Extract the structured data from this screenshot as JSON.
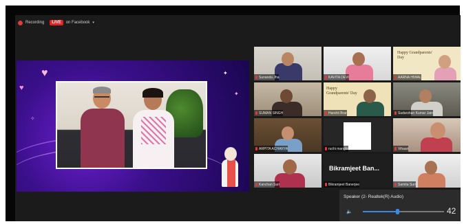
{
  "topbar": {
    "recording_label": "Recording",
    "live_label": "LIVE",
    "facebook_label": "on Facebook",
    "dropdown_glyph": "▾"
  },
  "participants": [
    {
      "name": "Sunanda Jha",
      "type": "video"
    },
    {
      "name": "KAVITA DEVI",
      "type": "video"
    },
    {
      "name": "AARNA HIWAL",
      "type": "video",
      "card_text": "Happy Grandparents' Day"
    },
    {
      "name": "SUMAN SINGH",
      "type": "video"
    },
    {
      "name": "Harshit Brar",
      "type": "video",
      "card_text": "Happy Grandparents' Day"
    },
    {
      "name": "Sudarshan Kumar Jain",
      "type": "video"
    },
    {
      "name": "ARPITA ACHARYA",
      "type": "video"
    },
    {
      "name": "ruchi mangla",
      "type": "blank"
    },
    {
      "name": "Vihaan",
      "type": "video"
    },
    {
      "name": "Kanchan Suri",
      "type": "video"
    },
    {
      "name": "Bikramjeet Banerjee",
      "type": "name",
      "display": "Bikramjeet   Ban..."
    },
    {
      "name": "Samita Suri",
      "type": "video"
    }
  ],
  "audio": {
    "label": "Speaker (2- Realtek(R) Audio)",
    "volume": 42,
    "volume_fraction": 0.42,
    "speaker_glyph": "🔈"
  },
  "colors": {
    "live_red": "#e02424",
    "accent_blue": "#3c88e6",
    "stage_purple": "#6c1fd0"
  }
}
